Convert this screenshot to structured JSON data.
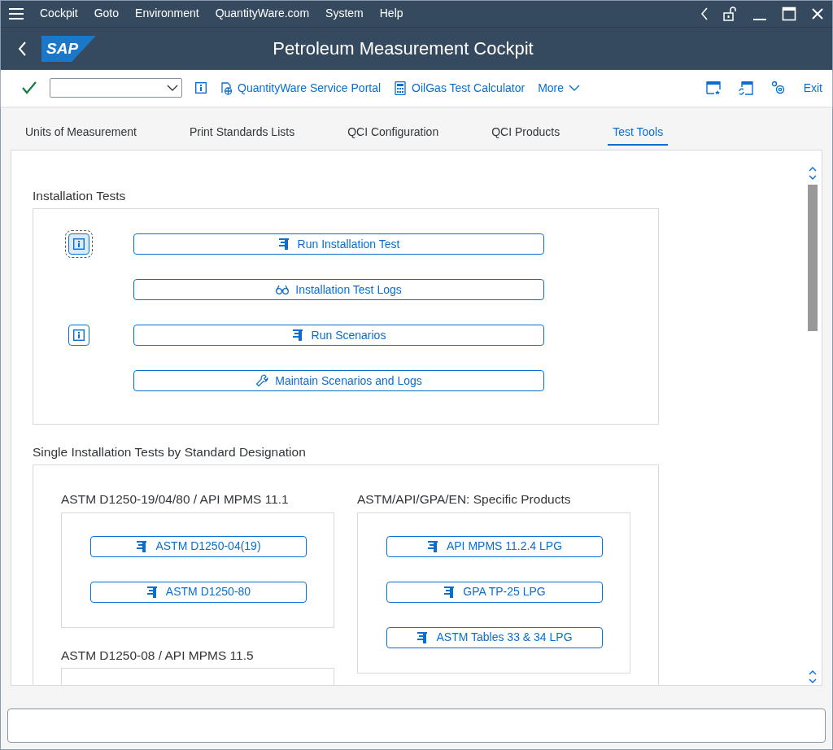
{
  "menu": [
    "Cockpit",
    "Goto",
    "Environment",
    "QuantityWare.com",
    "System",
    "Help"
  ],
  "title": "Petroleum Measurement Cockpit",
  "logo": "SAP",
  "toolbar": {
    "links": [
      "QuantityWare Service Portal",
      "OilGas Test Calculator"
    ],
    "more": "More",
    "exit": "Exit"
  },
  "tabs": [
    {
      "label": "Units of Measurement",
      "selected": false
    },
    {
      "label": "Print Standards Lists",
      "selected": false
    },
    {
      "label": "QCI Configuration",
      "selected": false
    },
    {
      "label": "QCI Products",
      "selected": false
    },
    {
      "label": "Test Tools",
      "selected": true
    }
  ],
  "installation_tests": {
    "title": "Installation Tests",
    "rows": [
      {
        "label": "Run Installation Test",
        "kind": "run",
        "info": true,
        "focused": true
      },
      {
        "label": "Installation Test Logs",
        "kind": "view",
        "info": false,
        "focused": false
      },
      {
        "label": "Run Scenarios",
        "kind": "run",
        "info": true,
        "focused": false
      },
      {
        "label": "Maintain Scenarios and Logs",
        "kind": "tool",
        "info": false,
        "focused": false
      }
    ]
  },
  "single_tests": {
    "title": "Single Installation Tests by Standard Designation",
    "groups": [
      {
        "title": "ASTM D1250-19/04/80 / API MPMS 11.1",
        "buttons": [
          "ASTM D1250-04(19)",
          "ASTM D1250-80"
        ]
      },
      {
        "title": "ASTM/API/GPA/EN: Specific Products",
        "buttons": [
          "API MPMS 11.2.4 LPG",
          "GPA TP-25 LPG",
          "ASTM Tables 33 & 34 LPG"
        ]
      },
      {
        "title": "ASTM D1250-08 / API MPMS 11.5"
      }
    ]
  }
}
